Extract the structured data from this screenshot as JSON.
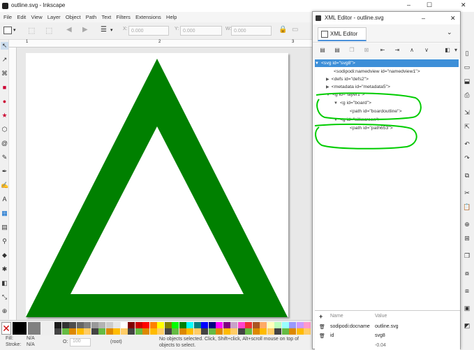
{
  "window": {
    "title": "outline.svg - Inkscape",
    "min": "–",
    "max": "☐",
    "close": "✕"
  },
  "menu": [
    "File",
    "Edit",
    "View",
    "Layer",
    "Object",
    "Path",
    "Text",
    "Filters",
    "Extensions",
    "Help"
  ],
  "toolbar": {
    "x_label": "X:",
    "x": "0.000",
    "y_label": "Y:",
    "y": "0.000",
    "w_label": "W:",
    "w": "0.000"
  },
  "ruler": {
    "t1": "1",
    "t2": "2",
    "t3": "3"
  },
  "canvas": {
    "triangle_color": "#008000"
  },
  "status": {
    "fill_label": "Fill:",
    "fill": "N/A",
    "stroke_label": "Stroke:",
    "stroke": "N/A",
    "opacity_label": "O:",
    "opacity": "100",
    "layer": "(root)",
    "message": "No objects selected. Click, Shift+click, Alt+scroll mouse on top of objects to select.",
    "coord": "-0.04"
  },
  "xml": {
    "title": "XML Editor - outline.svg",
    "tab": "XML Editor",
    "nodes": [
      {
        "t": "▼",
        "label": "<svg id=\"svg8\">"
      },
      {
        "t": "",
        "label": "<sodipodi:namedview id=\"namedview1\">"
      },
      {
        "t": "▶",
        "label": "<defs id=\"defs2\">"
      },
      {
        "t": "▶",
        "label": "<metadata id=\"metadata5\">"
      },
      {
        "t": "▼",
        "label": "<g id=\"layer1\">"
      },
      {
        "t": "▼",
        "label": "<g id=\"board\">"
      },
      {
        "t": "",
        "label": "<path id=\"boardoutline\">"
      },
      {
        "t": "▼",
        "label": "<g id=\"silkscreen\">"
      },
      {
        "t": "",
        "label": "<path id=\"path653\">"
      }
    ],
    "attr_header": {
      "name": "Name",
      "value": "Value",
      "plus": "+"
    },
    "attrs": [
      {
        "name": "sodipodi:docname",
        "value": "outline.svg"
      },
      {
        "name": "id",
        "value": "svg8"
      }
    ],
    "highlight_color": "#00cc00"
  }
}
